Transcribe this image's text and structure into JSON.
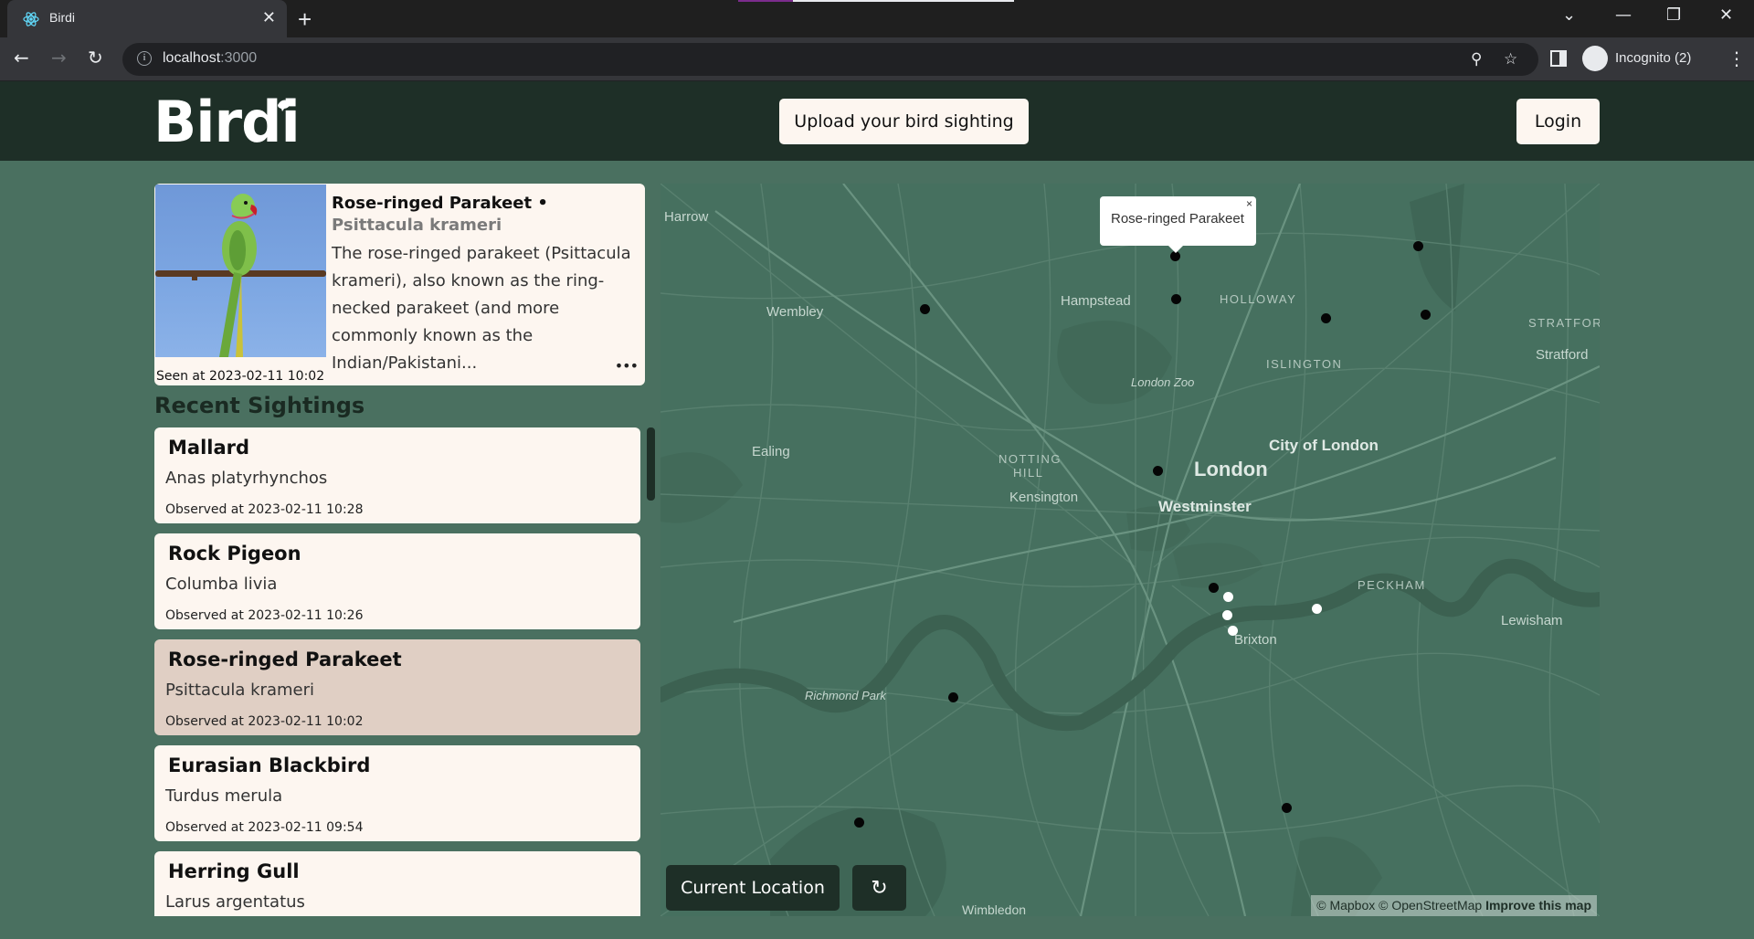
{
  "browser": {
    "tab_title": "Birdi",
    "url_host": "localhost",
    "url_port": ":3000",
    "profile_label": "Incognito (2)",
    "icons": {
      "favicon": "react-icon",
      "back": "back-arrow-icon",
      "forward": "forward-arrow-icon",
      "reload": "reload-icon",
      "location": "location-pin-icon",
      "bookmark": "star-icon",
      "side_panel": "side-panel-icon",
      "menu": "kebab-menu-icon"
    }
  },
  "header": {
    "logo_text": "Birdi",
    "upload_label": "Upload your bird sighting",
    "login_label": "Login"
  },
  "featured": {
    "common_name": "Rose-ringed Parakeet",
    "separator": " • ",
    "scientific_name": "Psittacula krameri",
    "description": "The rose-ringed parakeet (Psittacula krameri), also known as the ring-necked parakeet (and more commonly known as the Indian/Pakistani...",
    "seen": "Seen at 2023-02-11 10:02",
    "more_label": "•••"
  },
  "recent": {
    "title": "Recent Sightings",
    "items": [
      {
        "common": "Mallard",
        "scientific": "Anas platyrhynchos",
        "observed": "Observed at 2023-02-11 10:28",
        "selected": false
      },
      {
        "common": "Rock Pigeon",
        "scientific": "Columba livia",
        "observed": "Observed at 2023-02-11 10:26",
        "selected": false
      },
      {
        "common": "Rose-ringed Parakeet",
        "scientific": "Psittacula krameri",
        "observed": "Observed at 2023-02-11 10:02",
        "selected": true
      },
      {
        "common": "Eurasian Blackbird",
        "scientific": "Turdus merula",
        "observed": "Observed at 2023-02-11 09:54",
        "selected": false
      },
      {
        "common": "Herring Gull",
        "scientific": "Larus argentatus",
        "observed": "",
        "selected": false
      }
    ]
  },
  "map": {
    "popup_text": "Rose-ringed Parakeet",
    "popup_close": "×",
    "labels": {
      "harrow": "Harrow",
      "wembley": "Wembley",
      "hampstead": "Hampstead",
      "holloway": "HOLLOWAY",
      "stratford_caps": "STRATFOR",
      "stratford": "Stratford",
      "islington": "ISLINGTON",
      "london_zoo": "London Zoo",
      "ealing": "Ealing",
      "notting": "NOTTING",
      "hill": "HILL",
      "city_of_london": "City of London",
      "london": "London",
      "westminster": "Westminster",
      "kensington": "Kensington",
      "peckham": "PECKHAM",
      "lewisham": "Lewisham",
      "brixton": "Brixton",
      "richmond_park": "Richmond Park",
      "wimbledon": "Wimbledon"
    },
    "current_location_label": "Current Location",
    "refresh_icon": "refresh-icon",
    "attribution": "© Mapbox © OpenStreetMap",
    "improve_label": "Improve this map"
  },
  "colors": {
    "page_bg": "#4a7060",
    "header_bg": "#1e2f27",
    "card_bg": "#fdf6f0",
    "selected_bg": "#e0cfc4",
    "map_bg": "#46705f"
  }
}
